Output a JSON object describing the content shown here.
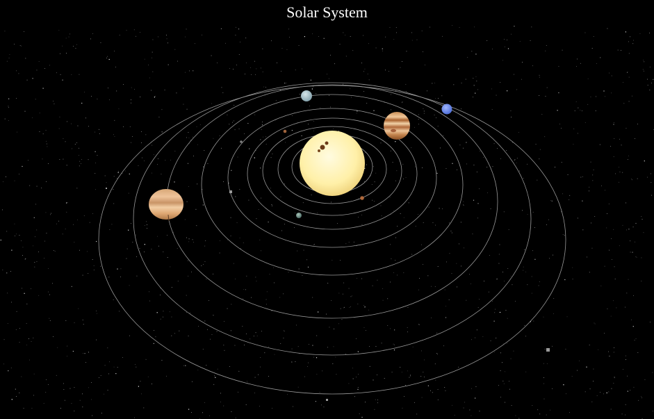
{
  "header": {
    "title": "Solar System"
  },
  "colors": {
    "background": "#000000",
    "orbit": "#9a9a9a",
    "star": "#ffffff"
  },
  "bodies": [
    {
      "name": "sun",
      "icon": "sun-icon",
      "color": "#fff3b0",
      "shade": "#f3d97a"
    },
    {
      "name": "mercury",
      "icon": "mercury-icon",
      "color": "#8a7a6a",
      "shade": "#5a4a3a"
    },
    {
      "name": "venus",
      "icon": "venus-icon",
      "color": "#b87a3c",
      "shade": "#7a4a20"
    },
    {
      "name": "earth",
      "icon": "earth-icon",
      "color": "#7f9f93",
      "shade": "#4f6f63"
    },
    {
      "name": "mars",
      "icon": "mars-icon",
      "color": "#a05a30",
      "shade": "#6a3618"
    },
    {
      "name": "jupiter",
      "icon": "jupiter-icon",
      "color": "#e0a46a",
      "shade": "#9a5a2a"
    },
    {
      "name": "saturn",
      "icon": "saturn-icon",
      "color": "#e9b47c",
      "shade": "#b07a48"
    },
    {
      "name": "uranus",
      "icon": "uranus-icon",
      "color": "#a9c3cc",
      "shade": "#6f8f99"
    },
    {
      "name": "neptune",
      "icon": "neptune-icon",
      "color": "#6d8ef0",
      "shade": "#3a5ac0"
    }
  ]
}
